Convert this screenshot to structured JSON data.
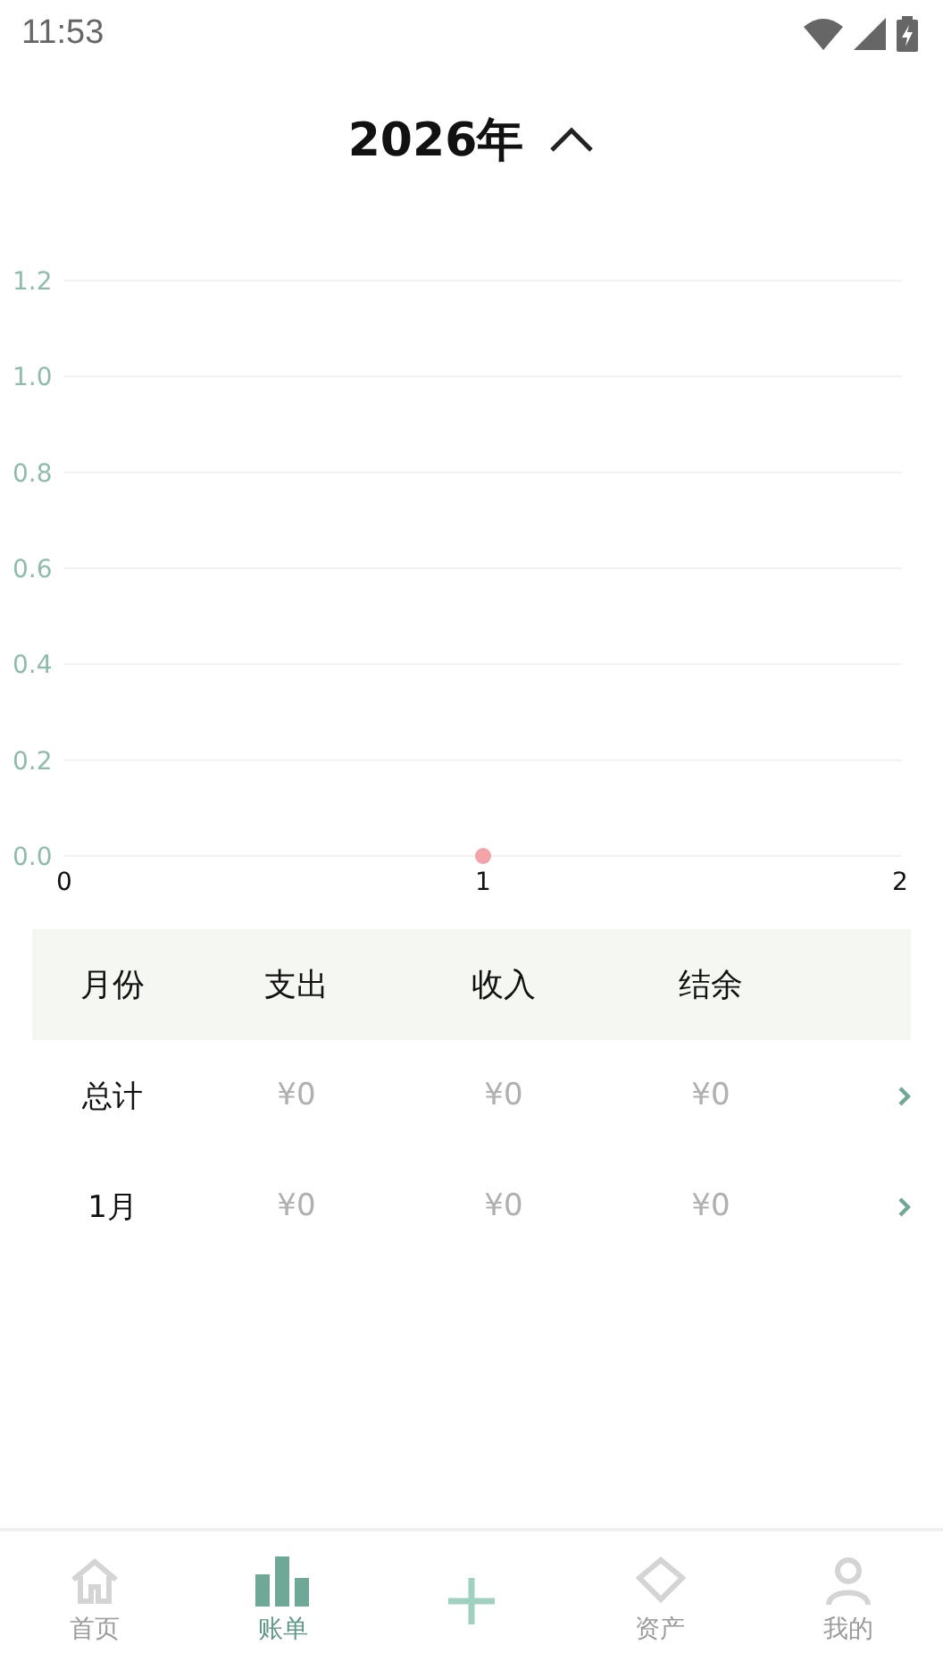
{
  "status_bar": {
    "time": "11:53"
  },
  "header": {
    "title": "2026年",
    "expanded": true
  },
  "chart": {
    "chart_data": {
      "type": "scatter",
      "grid": true,
      "x": [
        1
      ],
      "series": [
        {
          "color": "#f4a3a8",
          "values": [
            0
          ]
        }
      ],
      "xlim": [
        0,
        2
      ],
      "ylim": [
        0,
        1.2
      ],
      "xticks": [
        0,
        1,
        2
      ],
      "yticks": [
        {
          "value": 0,
          "label": "0.0"
        },
        {
          "value": 0.2,
          "label": "0.2"
        },
        {
          "value": 0.4,
          "label": "0.4"
        },
        {
          "value": 0.6,
          "label": "0.6"
        },
        {
          "value": 0.8,
          "label": "0.8"
        },
        {
          "value": 1,
          "label": "1.0"
        },
        {
          "value": 1.2,
          "label": "1.2"
        }
      ]
    }
  },
  "table": {
    "columns": [
      "月份",
      "支出",
      "收入",
      "结余"
    ],
    "rows": [
      {
        "cells": [
          "总计",
          "¥0",
          "¥0",
          "¥0"
        ]
      },
      {
        "cells": [
          "1月",
          "¥0",
          "¥0",
          "¥0"
        ]
      }
    ]
  },
  "bottom_nav": [
    {
      "kind": "home",
      "label": "首页",
      "selected": false
    },
    {
      "kind": "bills",
      "label": "账单",
      "selected": true
    },
    {
      "kind": "add",
      "selected": false
    },
    {
      "kind": "assets",
      "label": "资产",
      "selected": false
    },
    {
      "kind": "profile",
      "label": "我的",
      "selected": false
    }
  ]
}
